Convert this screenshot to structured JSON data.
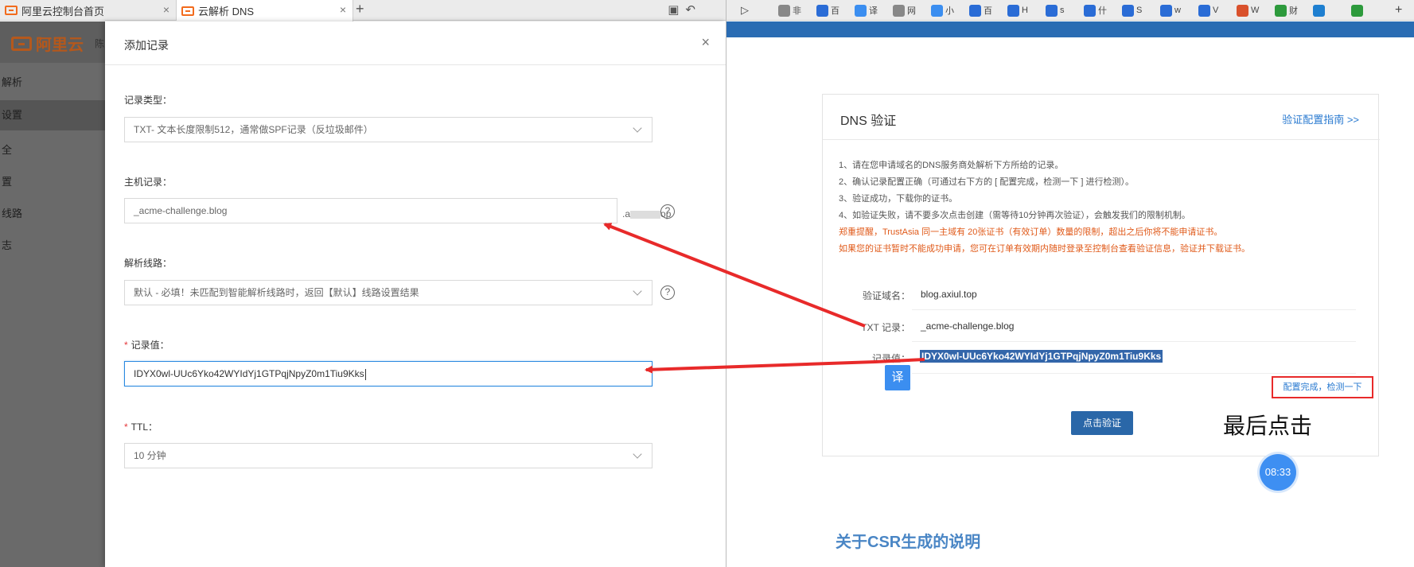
{
  "left_browser": {
    "tabs": [
      {
        "label": "阿里云控制台首页",
        "active": false
      },
      {
        "label": "云解析 DNS",
        "active": true
      }
    ]
  },
  "console": {
    "logo_text": "阿里云",
    "header_partial": "陈",
    "sidebar": [
      {
        "label": "解析",
        "selected": false
      },
      {
        "label": "设置",
        "selected": true
      },
      {
        "label": "全",
        "selected": false
      },
      {
        "label": "置",
        "selected": false
      },
      {
        "label": "线路",
        "selected": false
      },
      {
        "label": "志",
        "selected": false
      }
    ]
  },
  "modal": {
    "title": "添加记录",
    "close_glyph": "×",
    "record_type": {
      "label": "记录类型：",
      "value": "TXT- 文本长度限制512，通常做SPF记录（反垃圾邮件）"
    },
    "host": {
      "label": "主机记录：",
      "value": "_acme-challenge.blog",
      "suffix_start": ".a",
      "suffix_end": "op"
    },
    "line": {
      "label": "解析线路：",
      "value": "默认 - 必填！未匹配到智能解析线路时，返回【默认】线路设置结果"
    },
    "record_value": {
      "label": "记录值：",
      "value": "IDYX0wl-UUc6Yko42WYIdYj1GTPqjNpyZ0m1Tiu9Kks"
    },
    "ttl": {
      "label": "TTL：",
      "value": "10 分钟"
    },
    "required_mark": "*",
    "help_glyph": "?"
  },
  "right_browser": {
    "tabs": [
      "非",
      "百",
      "译",
      "网",
      "小",
      "百",
      "H",
      "s",
      "什",
      "S",
      "w",
      "V",
      "W",
      "财",
      "",
      ""
    ]
  },
  "dns_card": {
    "title": "DNS 验证",
    "guide_link": "验证配置指南 >>",
    "instructions": [
      "1、请在您申请域名的DNS服务商处解析下方所给的记录。",
      "2、确认记录配置正确（可通过右下方的 [ 配置完成，检测一下 ] 进行检测）。",
      "3、验证成功，下载你的证书。",
      "4、如验证失败，请不要多次点击创建（需等待10分钟再次验证），会触发我们的限制机制。"
    ],
    "warnings": [
      "郑重提醒，TrustAsia 同一主域有 20张证书（有效订单）数量的限制，超出之后你将不能申请证书。",
      "如果您的证书暂时不能成功申请，您可在订单有效期内随时登录至控制台查看验证信息，验证并下载证书。"
    ],
    "domain_label": "验证域名：",
    "domain_value": "blog.axiul.top",
    "txt_label": "TXT 记录：",
    "txt_value": "_acme-challenge.blog",
    "record_label": "记录值：",
    "record_value": "IDYX0wl-UUc6Yko42WYIdYj1GTPqjNpyZ0m1Tiu9Kks",
    "translate_label": "译",
    "check_link": "配置完成，检测一下",
    "verify_button": "点击验证",
    "annotation": "最后点击"
  },
  "clock": "08:33",
  "csr_heading": "关于CSR生成的说明",
  "colors": {
    "arrow": "#e82a2a",
    "link": "#2a7ad0",
    "brand": "#f26b1d"
  }
}
